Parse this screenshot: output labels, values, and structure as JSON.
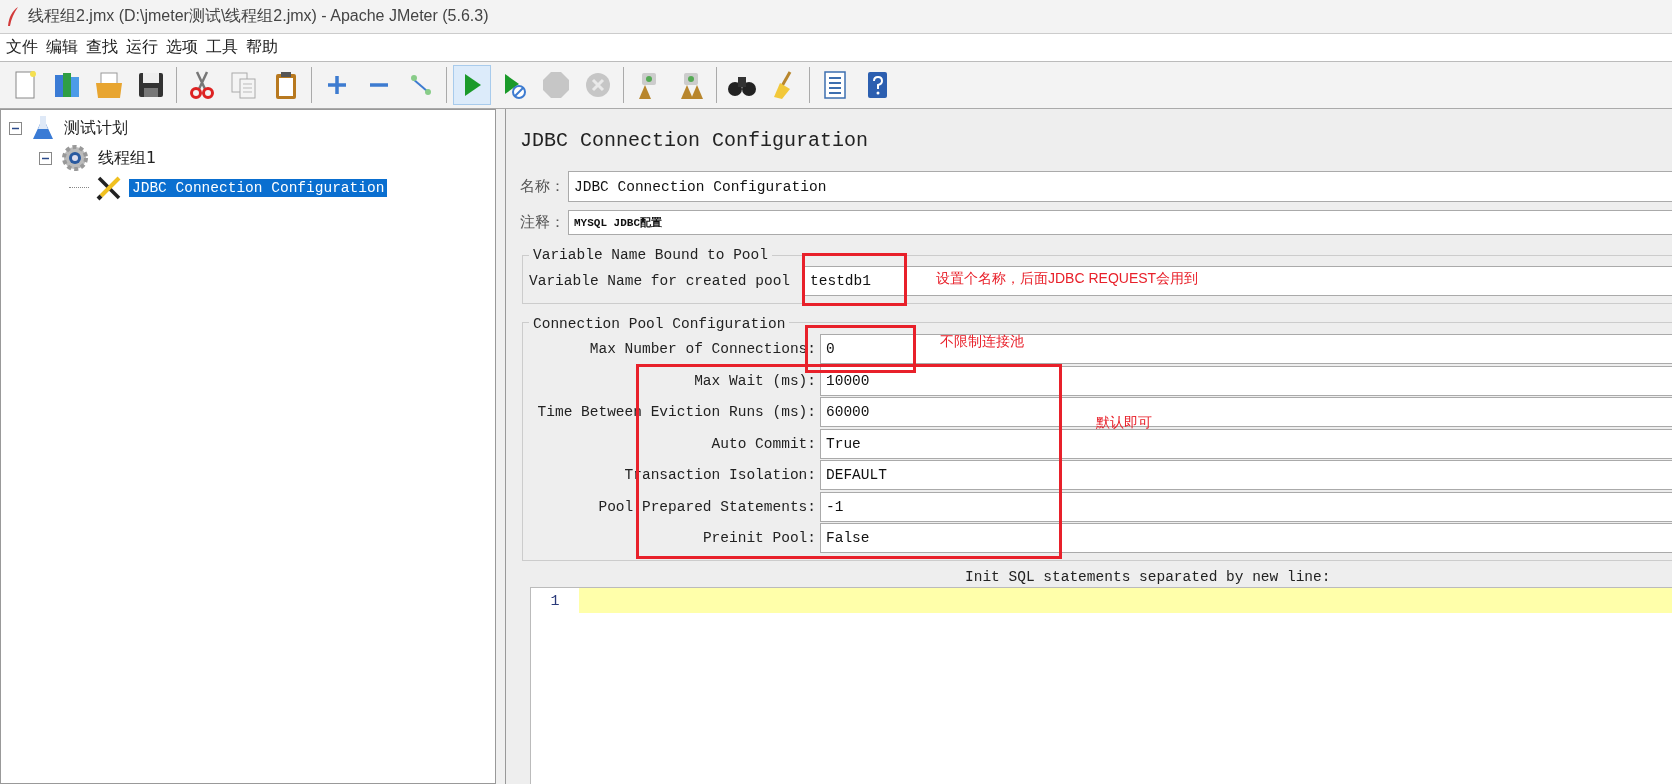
{
  "window": {
    "title": "线程组2.jmx (D:\\jmeter测试\\线程组2.jmx) - Apache JMeter (5.6.3)"
  },
  "menu": [
    "文件",
    "编辑",
    "查找",
    "运行",
    "选项",
    "工具",
    "帮助"
  ],
  "toolbar": [
    {
      "kind": "new",
      "selected": false,
      "disabled": false
    },
    {
      "kind": "templates",
      "selected": false,
      "disabled": false
    },
    {
      "kind": "open",
      "selected": false,
      "disabled": false
    },
    {
      "kind": "save",
      "selected": false,
      "disabled": false
    },
    {
      "kind": "separator"
    },
    {
      "kind": "cut",
      "selected": false,
      "disabled": false
    },
    {
      "kind": "copy",
      "selected": false,
      "disabled": false
    },
    {
      "kind": "paste",
      "selected": false,
      "disabled": false
    },
    {
      "kind": "separator"
    },
    {
      "kind": "expand",
      "selected": false,
      "disabled": false
    },
    {
      "kind": "collapse",
      "selected": false,
      "disabled": false
    },
    {
      "kind": "toggle",
      "selected": false,
      "disabled": false
    },
    {
      "kind": "separator"
    },
    {
      "kind": "start",
      "selected": true,
      "disabled": false
    },
    {
      "kind": "start-no-timers",
      "selected": false,
      "disabled": false
    },
    {
      "kind": "stop",
      "selected": false,
      "disabled": true
    },
    {
      "kind": "shutdown",
      "selected": false,
      "disabled": true
    },
    {
      "kind": "separator"
    },
    {
      "kind": "clear",
      "selected": false,
      "disabled": false
    },
    {
      "kind": "clear-all",
      "selected": false,
      "disabled": false
    },
    {
      "kind": "separator"
    },
    {
      "kind": "search",
      "selected": false,
      "disabled": false
    },
    {
      "kind": "reset-search",
      "selected": false,
      "disabled": false
    },
    {
      "kind": "separator"
    },
    {
      "kind": "functions",
      "selected": false,
      "disabled": false
    },
    {
      "kind": "help",
      "selected": false,
      "disabled": false
    }
  ],
  "tree": [
    {
      "label": "测试计划",
      "kind": "plan",
      "expanded": true,
      "selected": false,
      "children": [
        {
          "label": "线程组1",
          "kind": "thread-group",
          "expanded": true,
          "selected": false,
          "children": [
            {
              "label": "JDBC Connection Configuration",
              "kind": "config",
              "selected": true
            }
          ]
        }
      ]
    }
  ],
  "editor": {
    "title": "JDBC Connection Configuration",
    "name_label": "名称：",
    "name_value": "JDBC Connection Configuration",
    "comment_label": "注释：",
    "comment_value": "MYSQL JDBC配置",
    "groups": [
      {
        "legend": "Variable Name Bound to Pool",
        "rows": [
          {
            "label": "Variable Name for created pool",
            "value": "testdb1"
          }
        ]
      },
      {
        "legend": "Connection Pool Configuration",
        "rows": [
          {
            "label": "Max Number of Connections:",
            "value": "0"
          },
          {
            "label": "Max Wait (ms):",
            "value": "10000"
          },
          {
            "label": "Time Between Eviction Runs (ms):",
            "value": "60000"
          },
          {
            "label": "Auto Commit:",
            "value": "True"
          },
          {
            "label": "Transaction Isolation:",
            "value": "DEFAULT"
          },
          {
            "label": "Pool Prepared Statements:",
            "value": "-1"
          },
          {
            "label": "Preinit Pool:",
            "value": "False"
          }
        ]
      }
    ],
    "init_sql": {
      "label": "Init SQL statements separated by new line:",
      "line_numbers": [
        "1"
      ]
    }
  },
  "annotations": [
    {
      "text": "设置个名称，后面JDBC REQUEST会用到"
    },
    {
      "text": "不限制连接池"
    },
    {
      "text": "默认即可"
    }
  ]
}
